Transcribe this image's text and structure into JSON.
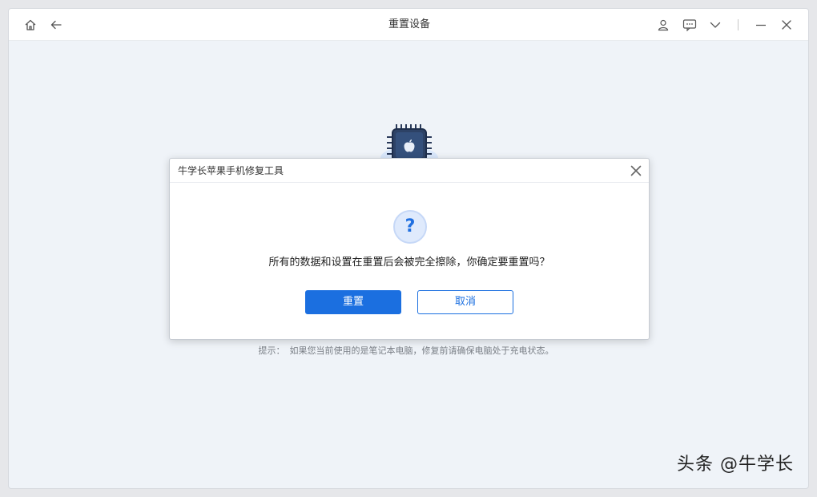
{
  "window": {
    "title": "重置设备"
  },
  "titlebar": {
    "left_icons": [
      "home-icon",
      "back-arrow-icon"
    ],
    "right_icons": [
      "user-icon",
      "feedback-icon",
      "chevron-down-icon",
      "minimize-icon",
      "close-icon"
    ]
  },
  "background": {
    "hint_label": "提示：",
    "hint_text": "如果您当前使用的是笔记本电脑，修复前请确保电脑处于充电状态。"
  },
  "dialog": {
    "title": "牛学长苹果手机修复工具",
    "icon": "question-icon",
    "icon_glyph": "?",
    "message": "所有的数据和设置在重置后会被完全擦除，你确定要重置吗？",
    "confirm_label": "重置",
    "cancel_label": "取消"
  },
  "colors": {
    "accent": "#1b6fe0",
    "background": "#eff3f8"
  },
  "watermark": "头条 @牛学长"
}
